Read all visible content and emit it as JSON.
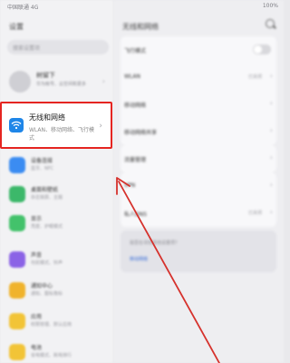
{
  "status_bar": {
    "left": "中国联通 4G",
    "right": "100%"
  },
  "left_panel": {
    "title": "设置",
    "search_placeholder": "搜索设置项",
    "account": {
      "name": "树留下",
      "subtitle": "华为帐号、云空间和更多"
    },
    "highlighted_item": {
      "title": "无线和网络",
      "subtitle": "WLAN、移动网络、飞行模式"
    },
    "items": [
      {
        "title": "设备连接",
        "subtitle": "蓝牙、NFC",
        "color": "#3b8cf2"
      },
      {
        "title": "桌面和壁纸",
        "subtitle": "杂志锁屏、主题",
        "color": "#3cb86a"
      },
      {
        "title": "显示",
        "subtitle": "亮度、护眼模式",
        "color": "#43c26b"
      },
      {
        "title": "声音",
        "subtitle": "勿扰模式、铃声",
        "color": "#8b63e6"
      },
      {
        "title": "通知中心",
        "subtitle": "通知、图标角标",
        "color": "#f0b32c"
      },
      {
        "title": "应用",
        "subtitle": "权限管理、默认应用",
        "color": "#f2c437"
      },
      {
        "title": "电池",
        "subtitle": "省电模式、耗电排行",
        "color": "#f2c437"
      }
    ]
  },
  "right_panel": {
    "title": "无线和网络",
    "rows": [
      {
        "label": "飞行模式",
        "value": "",
        "toggle": true
      },
      {
        "label": "WLAN",
        "value": "已关闭",
        "toggle": false
      },
      {
        "label": "移动网络",
        "value": "",
        "toggle": false
      },
      {
        "label": "移动网络共享",
        "value": "",
        "toggle": false
      },
      {
        "label": "流量管理",
        "value": "",
        "toggle": false
      },
      {
        "label": "VPN",
        "value": "",
        "toggle": false
      },
      {
        "label": "私人DNS",
        "value": "已关闭",
        "toggle": false
      }
    ],
    "help": {
      "question": "是否在寻找其他设置项?",
      "link": "移动网络"
    }
  },
  "colors": {
    "highlight_border": "#e52521",
    "arrow": "#d6322d",
    "wifi_icon_bg": "#1f86e8"
  }
}
